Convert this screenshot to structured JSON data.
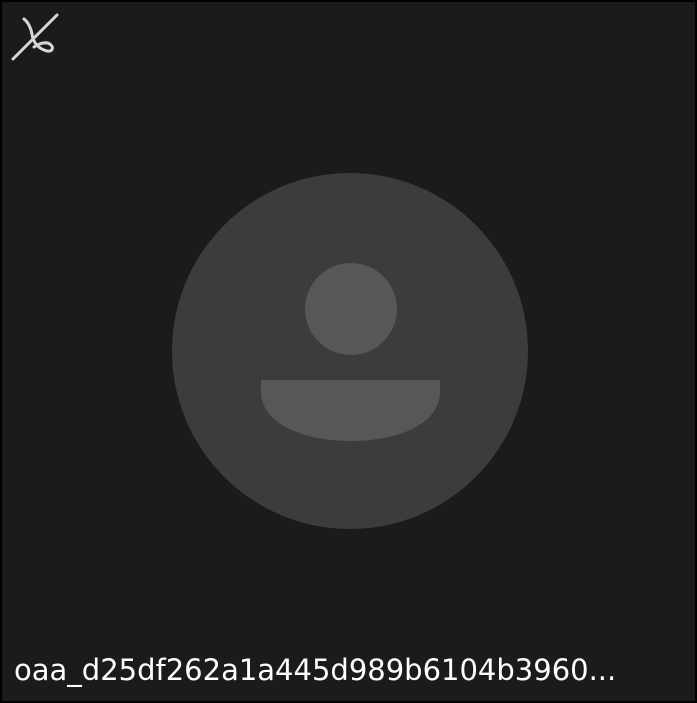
{
  "tile": {
    "participant_name": "oaa_d25df262a1a445d989b6104b3960...",
    "mic_status_icon": "microphone-off-icon",
    "avatar_icon": "person-placeholder-icon"
  },
  "colors": {
    "background": "#1b1b1b",
    "avatar_circle": "#3c3c3c",
    "avatar_figure": "#575757",
    "icon": "#d6d6d6",
    "text": "#ffffff"
  }
}
